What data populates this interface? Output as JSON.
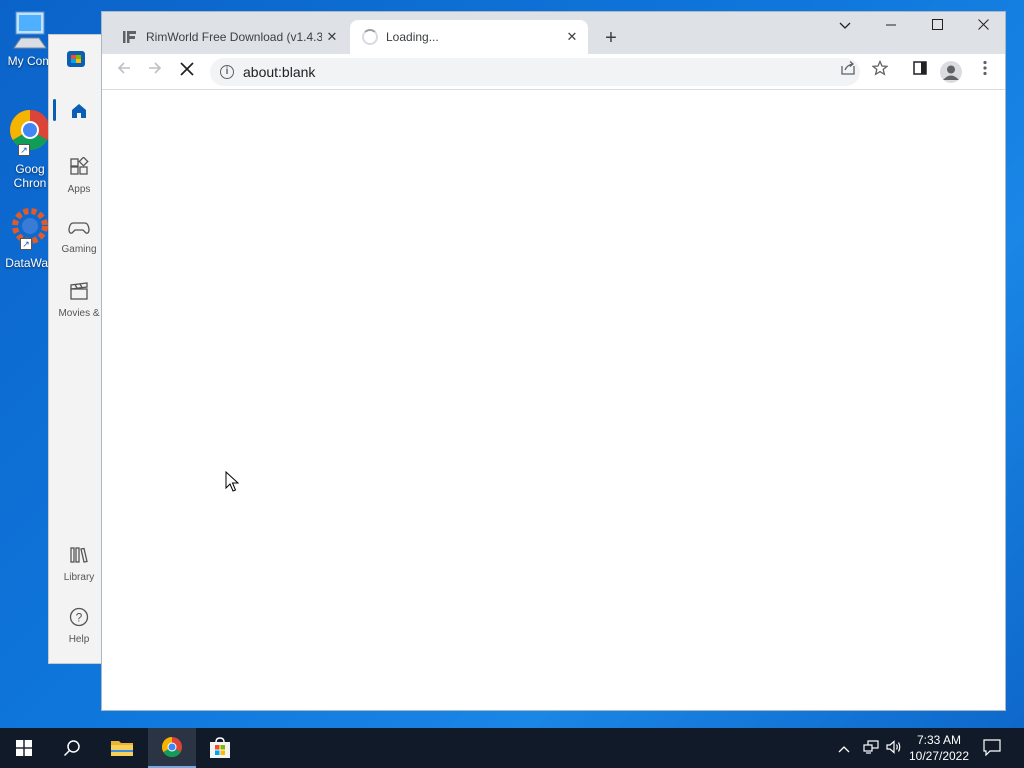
{
  "desktop": {
    "icons": [
      {
        "label": "My Com"
      },
      {
        "label": "Goog Chron"
      },
      {
        "label": "DataWag"
      }
    ]
  },
  "store": {
    "nav": [
      {
        "label": "Apps"
      },
      {
        "label": "Gaming"
      },
      {
        "label": "Movies &"
      },
      {
        "label": "Library"
      },
      {
        "label": "Help"
      }
    ]
  },
  "browser": {
    "tabs": [
      {
        "title": "RimWorld Free Download (v1.4.3",
        "active": false
      },
      {
        "title": "Loading...",
        "active": true
      }
    ],
    "url": "about:blank"
  },
  "taskbar": {
    "time": "7:33 AM",
    "date": "10/27/2022"
  },
  "colors": {
    "accent": "#0a5fb4",
    "taskbar": "#101a28",
    "tab_strip": "#dee1e6"
  }
}
